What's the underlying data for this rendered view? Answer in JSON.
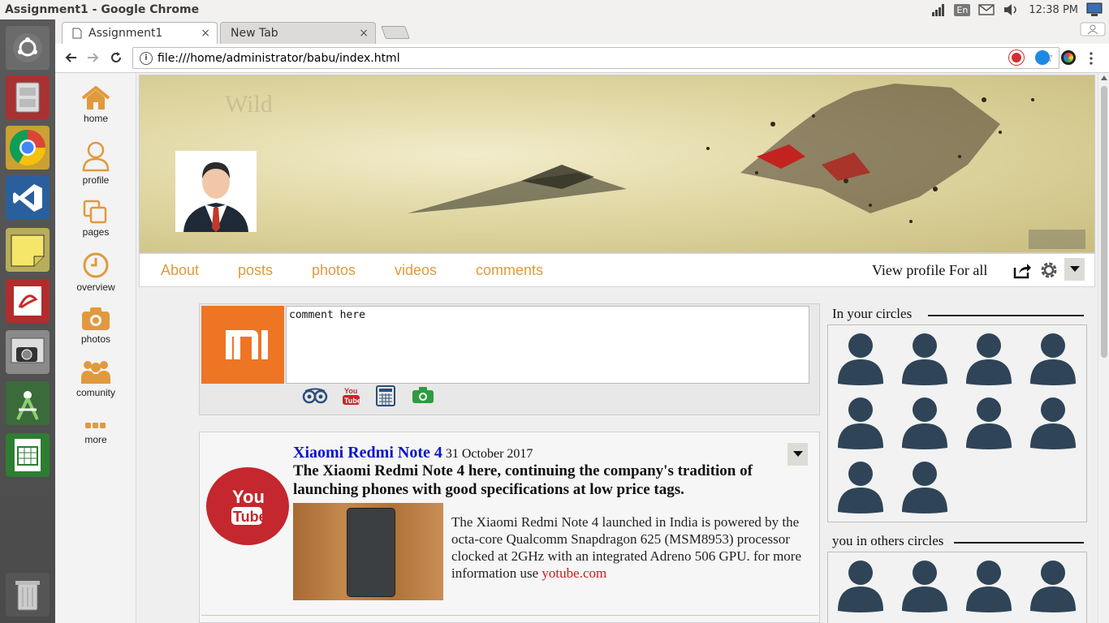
{
  "os": {
    "window_title": "Assignment1 - Google Chrome",
    "keyboard": "En",
    "clock": "12:38 PM"
  },
  "browser": {
    "tabs": [
      {
        "label": "Assignment1",
        "close": "×"
      },
      {
        "label": "New Tab",
        "close": "×"
      }
    ],
    "url": "file:///home/administrator/babu/index.html",
    "info_icon": "i",
    "star": "☆"
  },
  "nav": {
    "items": [
      {
        "label": "home",
        "icon": "home-icon"
      },
      {
        "label": "profile",
        "icon": "user-icon"
      },
      {
        "label": "pages",
        "icon": "pages-icon"
      },
      {
        "label": "overview",
        "icon": "clock-icon"
      },
      {
        "label": "photos",
        "icon": "camera-icon"
      },
      {
        "label": "comunity",
        "icon": "community-icon"
      },
      {
        "label": "more",
        "icon": "more-icon"
      }
    ]
  },
  "menu": {
    "links": [
      "About",
      "posts",
      "photos",
      "videos",
      "comments"
    ],
    "view_profile": "View profile For all"
  },
  "composer": {
    "placeholder": "comment here",
    "accent": "#ee7524"
  },
  "post": {
    "title": "Xiaomi Redmi Note 4",
    "date": "31 October 2017",
    "headline": "The Xiaomi Redmi Note 4 here, continuing the company's tradition of launching phones with good specifications at low price tags.",
    "body": "The Xiaomi Redmi Note 4 launched in India is powered by the octa-core Qualcomm Snapdragon 625 (MSM8953) processor clocked at 2GHz with an integrated Adreno 506 GPU. for more information use ",
    "link": "yotube.com",
    "yt_top": "You",
    "yt_bottom": "Tube"
  },
  "circles": {
    "in_your": "In your circles",
    "in_others": "you in others circles"
  },
  "colors": {
    "nav_accent": "#e09a3d",
    "person": "#2f4457",
    "title_link": "#0c15c7",
    "body_link": "#d0181e"
  }
}
